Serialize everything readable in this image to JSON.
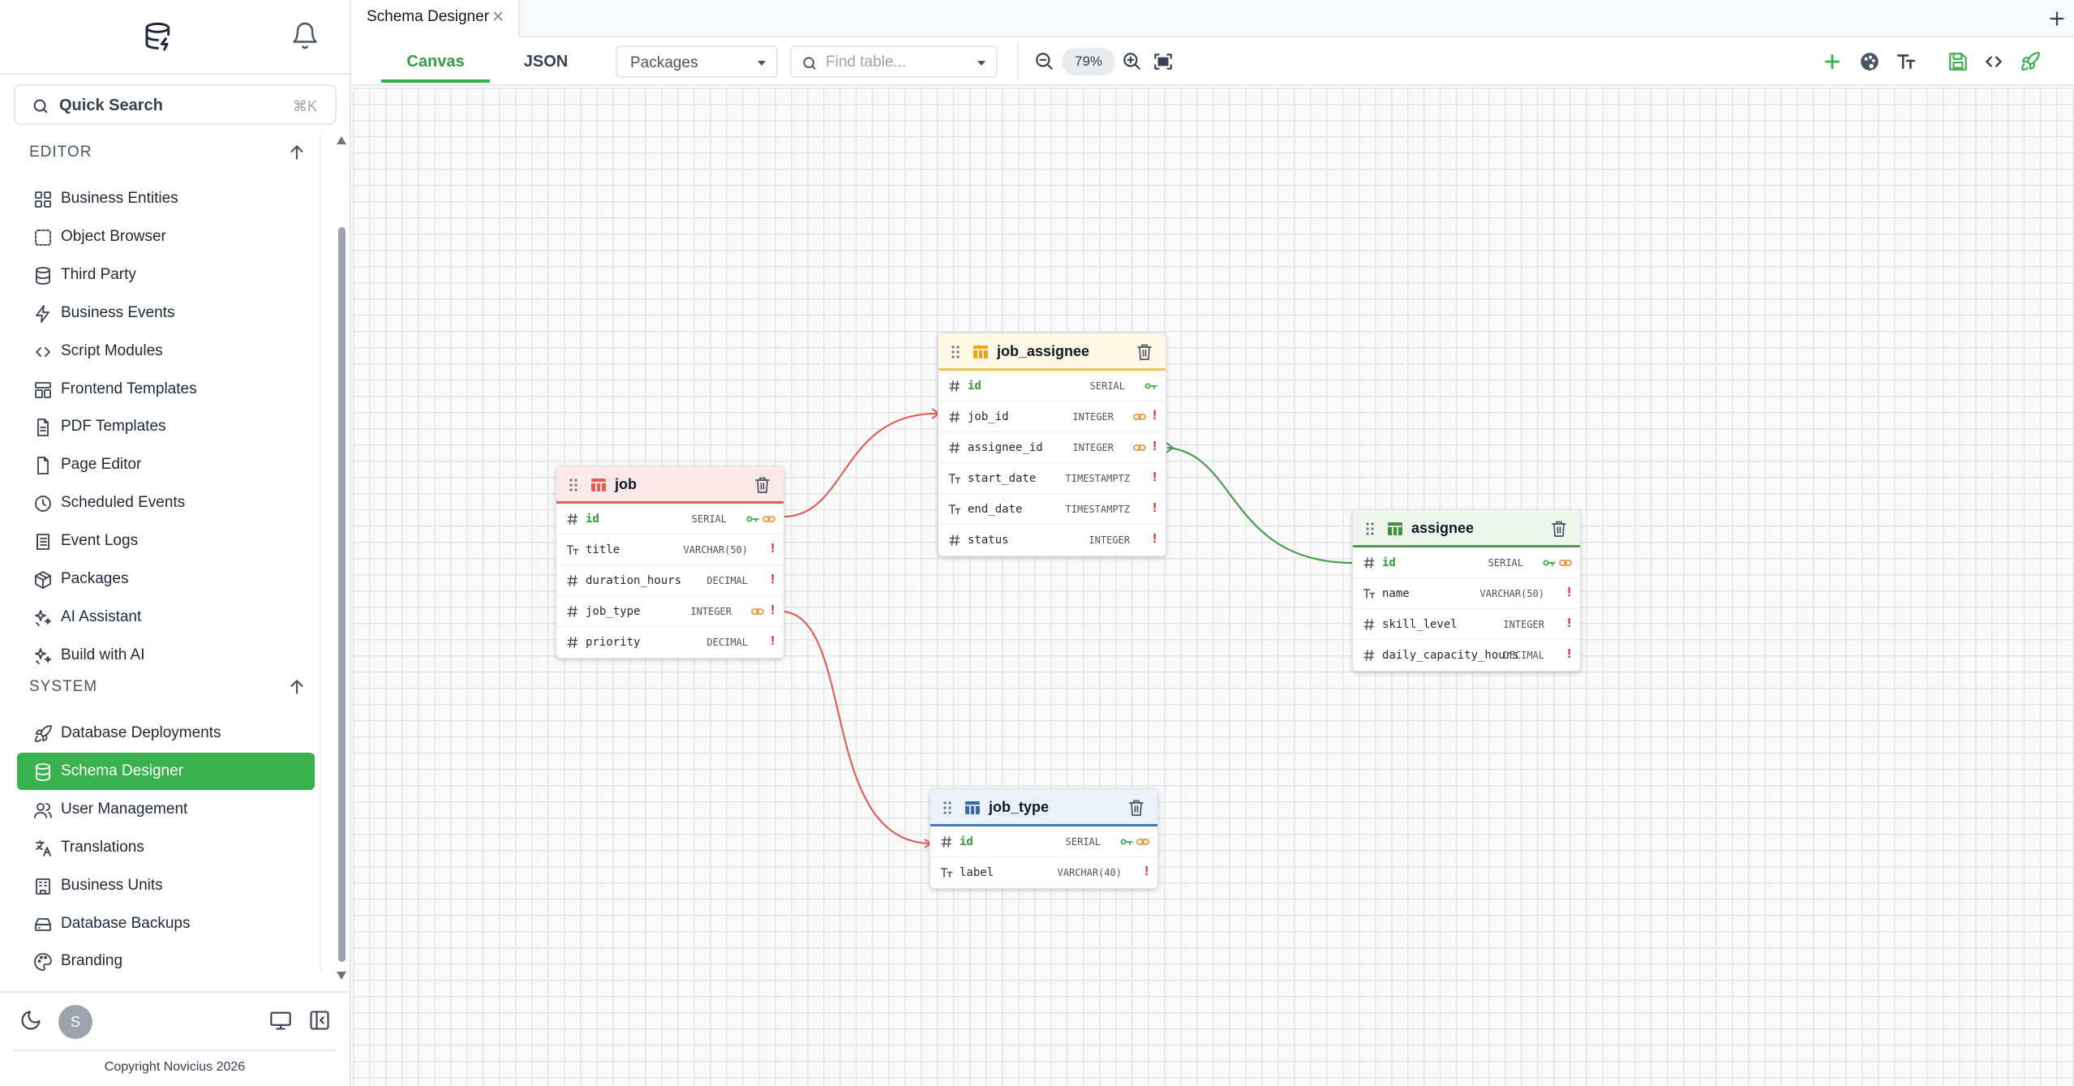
{
  "app": {
    "quick_search": "Quick Search",
    "quick_search_kbd": "⌘K",
    "copyright": "Copyright Novicius 2026",
    "avatar_initial": "S"
  },
  "sidebar": {
    "editor_title": "EDITOR",
    "system_title": "SYSTEM",
    "editor_items": [
      {
        "label": "Business Entities",
        "icon": "entities-icon"
      },
      {
        "label": "Object Browser",
        "icon": "object-browser-icon"
      },
      {
        "label": "Third Party",
        "icon": "database-icon"
      },
      {
        "label": "Business Events",
        "icon": "lightning-icon"
      },
      {
        "label": "Script Modules",
        "icon": "code-icon"
      },
      {
        "label": "Frontend Templates",
        "icon": "layout-icon"
      },
      {
        "label": "PDF Templates",
        "icon": "document-icon"
      },
      {
        "label": "Page Editor",
        "icon": "page-icon"
      },
      {
        "label": "Scheduled Events",
        "icon": "clock-icon"
      },
      {
        "label": "Event Logs",
        "icon": "log-icon"
      },
      {
        "label": "Packages",
        "icon": "package-icon"
      },
      {
        "label": "AI Assistant",
        "icon": "sparkles-icon"
      },
      {
        "label": "Build with AI",
        "icon": "sparkles-icon"
      }
    ],
    "system_items": [
      {
        "label": "Database Deployments",
        "icon": "rocket-icon"
      },
      {
        "label": "Schema Designer",
        "icon": "database-icon",
        "active": true
      },
      {
        "label": "User Management",
        "icon": "users-icon"
      },
      {
        "label": "Translations",
        "icon": "translate-icon"
      },
      {
        "label": "Business Units",
        "icon": "building-icon"
      },
      {
        "label": "Database Backups",
        "icon": "backup-icon"
      },
      {
        "label": "Branding",
        "icon": "palette-icon"
      }
    ]
  },
  "header": {
    "tab_label": "Schema Designer",
    "view_tabs": [
      "Canvas",
      "JSON"
    ],
    "active_view": "Canvas",
    "package_select": "Packages",
    "find_placeholder": "Find table...",
    "zoom": "79%"
  },
  "colors": {
    "accent": "#3ab14f",
    "link_red": "#e0605a",
    "link_green": "#4e9a4e",
    "job_header": "#fbe9e9",
    "job_assignee_header": "#fff8e5",
    "assignee_header": "#eef5ec",
    "job_type_header": "#ecf1f7"
  },
  "tables": [
    {
      "name": "job",
      "color": "red",
      "fields": [
        {
          "name": "id",
          "type": "SERIAL",
          "pk": true,
          "key": true,
          "link": true,
          "required": false
        },
        {
          "name": "title",
          "type": "VARCHAR(50)",
          "kind": "text",
          "required": true
        },
        {
          "name": "duration_hours",
          "type": "DECIMAL",
          "required": true
        },
        {
          "name": "job_type",
          "type": "INTEGER",
          "link": true,
          "required": true
        },
        {
          "name": "priority",
          "type": "DECIMAL",
          "required": true
        }
      ]
    },
    {
      "name": "job_assignee",
      "color": "yellow",
      "fields": [
        {
          "name": "id",
          "type": "SERIAL",
          "pk": true,
          "key": true,
          "required": false
        },
        {
          "name": "job_id",
          "type": "INTEGER",
          "link": true,
          "required": true
        },
        {
          "name": "assignee_id",
          "type": "INTEGER",
          "link": true,
          "required": true
        },
        {
          "name": "start_date",
          "type": "TIMESTAMPTZ",
          "kind": "text",
          "required": true
        },
        {
          "name": "end_date",
          "type": "TIMESTAMPTZ",
          "kind": "text",
          "required": true
        },
        {
          "name": "status",
          "type": "INTEGER",
          "required": true
        }
      ]
    },
    {
      "name": "assignee",
      "color": "green",
      "fields": [
        {
          "name": "id",
          "type": "SERIAL",
          "pk": true,
          "key": true,
          "link": true,
          "required": false
        },
        {
          "name": "name",
          "type": "VARCHAR(50)",
          "kind": "text",
          "required": true
        },
        {
          "name": "skill_level",
          "type": "INTEGER",
          "required": true
        },
        {
          "name": "daily_capacity_hours",
          "type": "DECIMAL",
          "required": true
        }
      ]
    },
    {
      "name": "job_type",
      "color": "blue",
      "fields": [
        {
          "name": "id",
          "type": "SERIAL",
          "pk": true,
          "key": true,
          "link": true,
          "required": false
        },
        {
          "name": "label",
          "type": "VARCHAR(40)",
          "kind": "text",
          "required": true
        }
      ]
    }
  ]
}
